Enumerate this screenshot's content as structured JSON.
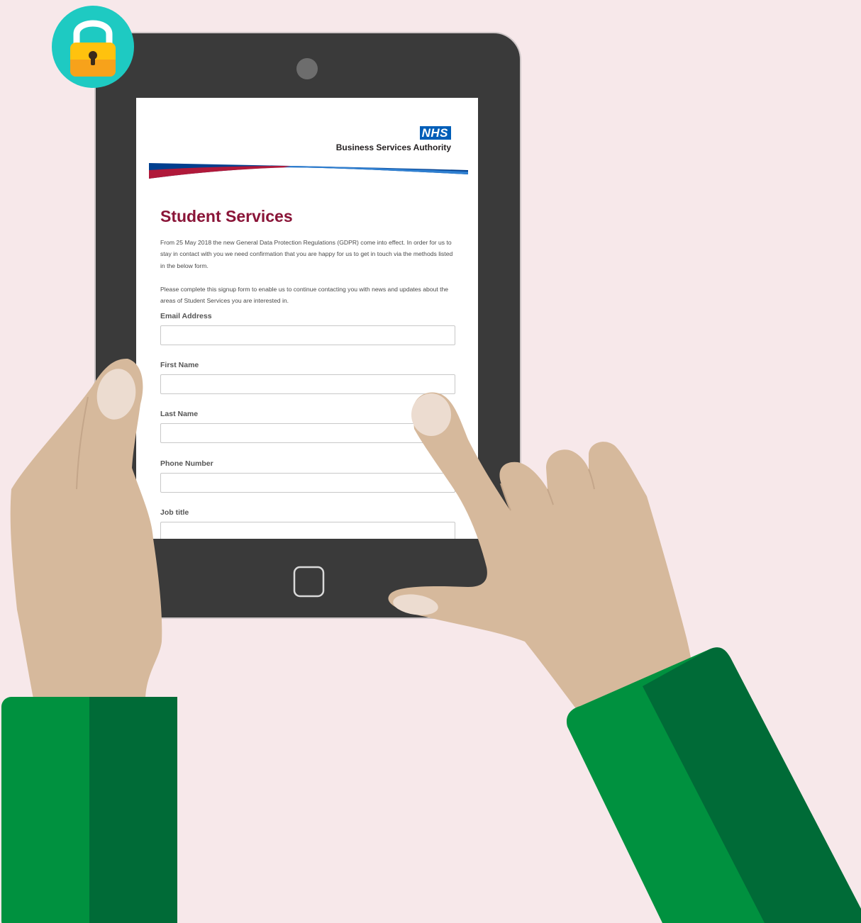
{
  "page": {
    "background": "#f7e8ea",
    "brand_blue": "#005eb8",
    "title_color": "#8a1538",
    "sleeve_green": "#00913f",
    "sleeve_green_dark": "#006b37",
    "skin": "#d6b99c",
    "lock_badge_color": "#1ecac2"
  },
  "icons": {
    "lock": "padlock-icon",
    "camera": "front-camera-icon",
    "home": "home-button-icon"
  },
  "header": {
    "logo_text": "NHS",
    "org_name": "Business Services Authority"
  },
  "form": {
    "title": "Student Services",
    "intro_1": "From 25 May 2018 the new General Data Protection Regulations (GDPR) come into effect. In order for us to stay in contact with you we need confirmation that you are happy for us to get in touch via the methods listed in the below form.",
    "intro_2": "Please complete this signup form to enable us to continue contacting you with news and updates about the areas of Student Services you are interested in.",
    "fields": [
      {
        "label": "Email Address",
        "value": ""
      },
      {
        "label": "First Name",
        "value": ""
      },
      {
        "label": "Last Name",
        "value": ""
      },
      {
        "label": "Phone Number",
        "value": ""
      },
      {
        "label": "Job title",
        "value": ""
      }
    ]
  }
}
